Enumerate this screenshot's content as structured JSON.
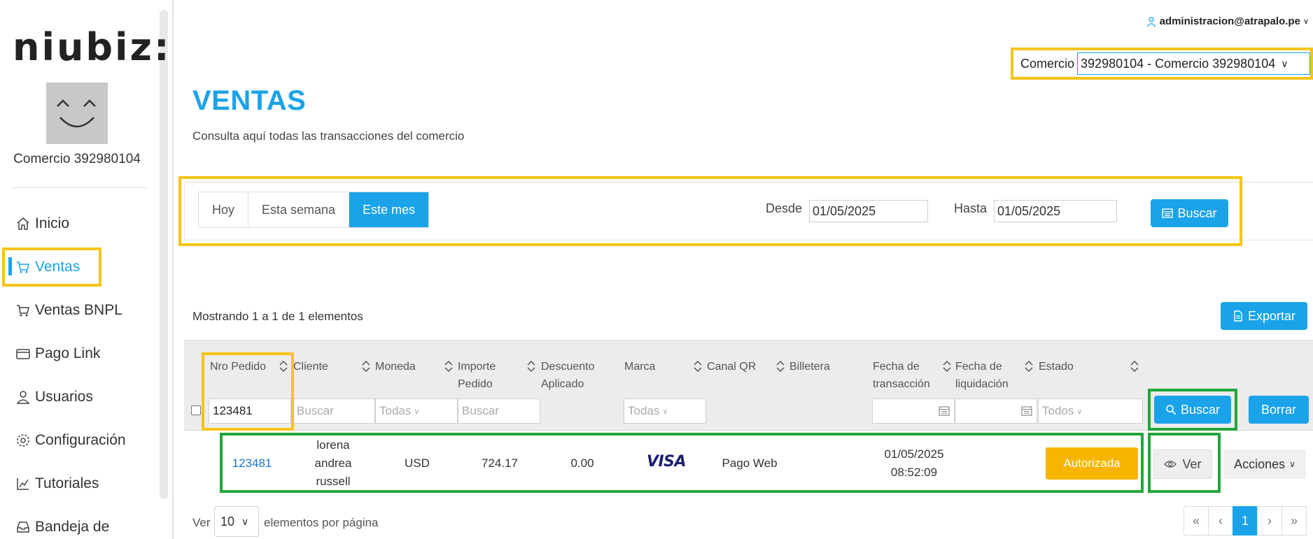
{
  "brand": {
    "logo_text": "niubiz:"
  },
  "sidebar": {
    "comercio_name": "Comercio 392980104",
    "items": [
      {
        "label": "Inicio",
        "icon": "home-icon"
      },
      {
        "label": "Ventas",
        "icon": "cart-icon",
        "active": true
      },
      {
        "label": "Ventas BNPL",
        "icon": "cart-icon"
      },
      {
        "label": "Pago Link",
        "icon": "card-icon"
      },
      {
        "label": "Usuarios",
        "icon": "user-icon"
      },
      {
        "label": "Configuración",
        "icon": "gear-icon"
      },
      {
        "label": "Tutoriales",
        "icon": "chart-icon"
      },
      {
        "label": "Bandeja de",
        "icon": "inbox-icon"
      }
    ]
  },
  "header": {
    "user_email": "administracion@atrapalo.pe",
    "comercio_label": "Comercio",
    "comercio_value": "392980104 - Comercio 392980104"
  },
  "page": {
    "title": "VENTAS",
    "subtitle": "Consulta aquí todas las transacciones del comercio"
  },
  "filters": {
    "periods": [
      "Hoy",
      "Esta semana",
      "Este mes"
    ],
    "active_period": "Este mes",
    "desde_label": "Desde",
    "desde_value": "01/05/2025",
    "hasta_label": "Hasta",
    "hasta_value": "01/05/2025",
    "buscar_label": "Buscar"
  },
  "table": {
    "showing_text": "Mostrando 1 a 1 de 1 elementos",
    "export_label": "Exportar",
    "columns": {
      "nro_pedido": "Nro Pedido",
      "cliente": "Cliente",
      "moneda": "Moneda",
      "importe_1": "Importe",
      "importe_2": "Pedido",
      "descuento_1": "Descuento",
      "descuento_2": "Aplicado",
      "marca": "Marca",
      "canal_qr": "Canal QR",
      "billetera": "Billetera",
      "fecha_tx_1": "Fecha de",
      "fecha_tx_2": "transacción",
      "fecha_liq_1": "Fecha de",
      "fecha_liq_2": "liquidación",
      "estado": "Estado"
    },
    "column_filters": {
      "nro_pedido_value": "123481",
      "cliente_placeholder": "Buscar",
      "moneda_placeholder": "Todas",
      "importe_placeholder": "Buscar",
      "marca_placeholder": "Todas",
      "estado_placeholder": "Todos",
      "buscar_label": "Buscar",
      "borrar_label": "Borrar"
    },
    "rows": [
      {
        "nro_pedido": "123481",
        "cliente_line1": "lorena",
        "cliente_line2": "andrea",
        "cliente_line3": "russell",
        "moneda": "USD",
        "importe": "724.17",
        "descuento": "0.00",
        "marca": "VISA",
        "canal": "Pago Web",
        "fecha_date": "01/05/2025",
        "fecha_time": "08:52:09",
        "estado": "Autorizada",
        "ver_label": "Ver",
        "acciones_label": "Acciones"
      }
    ]
  },
  "footer": {
    "ver_label": "Ver",
    "per_page": "10",
    "per_page_suffix": "elementos por página",
    "pages": [
      "«",
      "‹",
      "1",
      "›",
      "»"
    ],
    "current_page": "1"
  },
  "colors": {
    "accent": "#1aa3e8",
    "highlight_yellow": "#f5c518",
    "highlight_green": "#22a63a",
    "status_authorized": "#f7b500",
    "visa_blue": "#1a1f71"
  }
}
